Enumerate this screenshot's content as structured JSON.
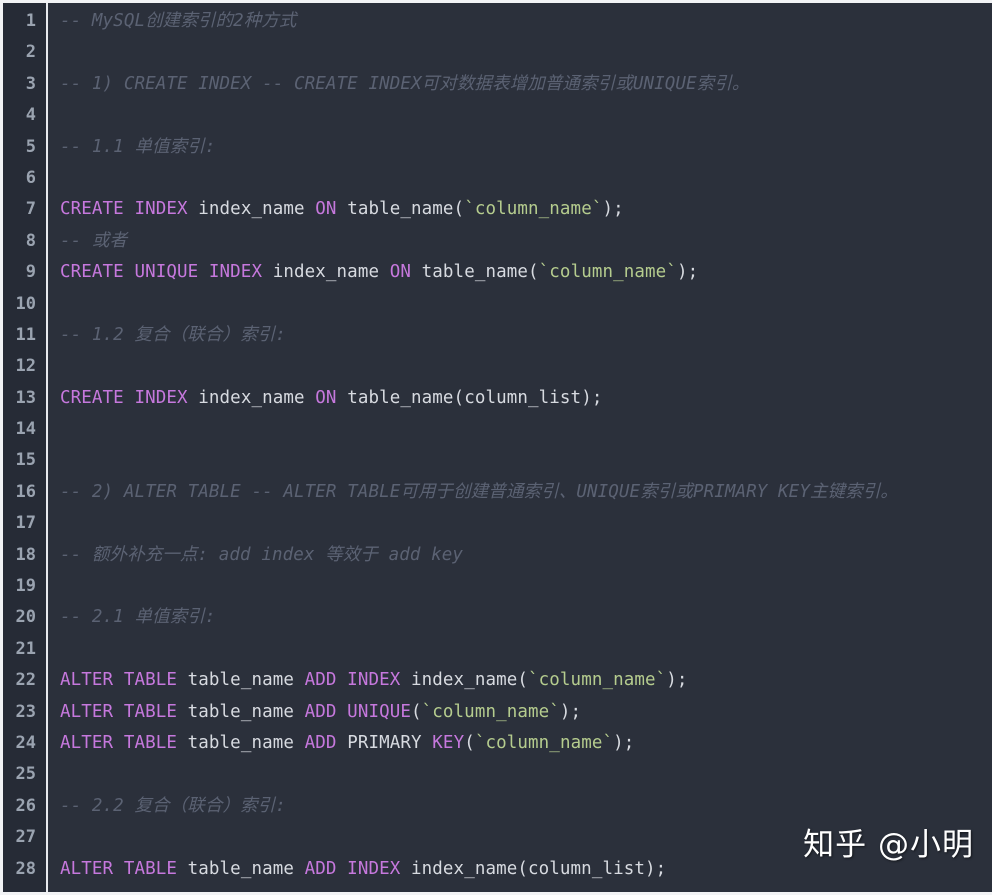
{
  "editor": {
    "language": "sql",
    "theme": "one-dark",
    "total_lines": 28,
    "colors": {
      "background": "#2b303b",
      "gutter_background": "#262b36",
      "gutter_separator": "#e8eaee",
      "frame_border": "#f2f3f5",
      "line_number": "#9aa3b0",
      "comment": "#5b6273",
      "keyword": "#c678dd",
      "identifier": "#d7dae0",
      "string": "#b5cc8e",
      "watermark": "#ffffff"
    }
  },
  "watermark": {
    "text": "知乎 @小明"
  },
  "lines": [
    {
      "n": "1",
      "tokens": [
        {
          "t": "-- MySQL创建索引的2种方式",
          "c": "comment"
        }
      ]
    },
    {
      "n": "2",
      "tokens": []
    },
    {
      "n": "3",
      "tokens": [
        {
          "t": "-- 1) CREATE INDEX -- CREATE INDEX可对数据表增加普通索引或UNIQUE索引。",
          "c": "comment"
        }
      ]
    },
    {
      "n": "4",
      "tokens": []
    },
    {
      "n": "5",
      "tokens": [
        {
          "t": "-- 1.1 单值索引:",
          "c": "comment"
        }
      ]
    },
    {
      "n": "6",
      "tokens": []
    },
    {
      "n": "7",
      "tokens": [
        {
          "t": "CREATE INDEX",
          "c": "keyword"
        },
        {
          "t": " index_name ",
          "c": "ident"
        },
        {
          "t": "ON",
          "c": "keyword"
        },
        {
          "t": " table_name(",
          "c": "ident"
        },
        {
          "t": "`column_name`",
          "c": "string"
        },
        {
          "t": ");",
          "c": "punct"
        }
      ]
    },
    {
      "n": "8",
      "tokens": [
        {
          "t": "-- 或者",
          "c": "comment"
        }
      ]
    },
    {
      "n": "9",
      "tokens": [
        {
          "t": "CREATE UNIQUE INDEX",
          "c": "keyword"
        },
        {
          "t": " index_name ",
          "c": "ident"
        },
        {
          "t": "ON",
          "c": "keyword"
        },
        {
          "t": " table_name(",
          "c": "ident"
        },
        {
          "t": "`column_name`",
          "c": "string"
        },
        {
          "t": ");",
          "c": "punct"
        }
      ]
    },
    {
      "n": "10",
      "tokens": []
    },
    {
      "n": "11",
      "tokens": [
        {
          "t": "-- 1.2 复合（联合）索引:",
          "c": "comment"
        }
      ]
    },
    {
      "n": "12",
      "tokens": []
    },
    {
      "n": "13",
      "tokens": [
        {
          "t": "CREATE INDEX",
          "c": "keyword"
        },
        {
          "t": " index_name ",
          "c": "ident"
        },
        {
          "t": "ON",
          "c": "keyword"
        },
        {
          "t": " table_name(column_list);",
          "c": "ident"
        }
      ]
    },
    {
      "n": "14",
      "tokens": []
    },
    {
      "n": "15",
      "tokens": []
    },
    {
      "n": "16",
      "tokens": [
        {
          "t": "-- 2) ALTER TABLE -- ALTER TABLE可用于创建普通索引、UNIQUE索引或PRIMARY KEY主键索引。",
          "c": "comment"
        }
      ]
    },
    {
      "n": "17",
      "tokens": []
    },
    {
      "n": "18",
      "tokens": [
        {
          "t": "-- 额外补充一点: add index 等效于 add key",
          "c": "comment"
        }
      ]
    },
    {
      "n": "19",
      "tokens": []
    },
    {
      "n": "20",
      "tokens": [
        {
          "t": "-- 2.1 单值索引:",
          "c": "comment"
        }
      ]
    },
    {
      "n": "21",
      "tokens": []
    },
    {
      "n": "22",
      "tokens": [
        {
          "t": "ALTER TABLE",
          "c": "keyword"
        },
        {
          "t": " table_name ",
          "c": "ident"
        },
        {
          "t": "ADD INDEX",
          "c": "keyword"
        },
        {
          "t": " index_name(",
          "c": "ident"
        },
        {
          "t": "`column_name`",
          "c": "string"
        },
        {
          "t": ");",
          "c": "punct"
        }
      ]
    },
    {
      "n": "23",
      "tokens": [
        {
          "t": "ALTER TABLE",
          "c": "keyword"
        },
        {
          "t": " table_name ",
          "c": "ident"
        },
        {
          "t": "ADD UNIQUE",
          "c": "keyword"
        },
        {
          "t": "(",
          "c": "punct"
        },
        {
          "t": "`column_name`",
          "c": "string"
        },
        {
          "t": ");",
          "c": "punct"
        }
      ]
    },
    {
      "n": "24",
      "tokens": [
        {
          "t": "ALTER TABLE",
          "c": "keyword"
        },
        {
          "t": " table_name ",
          "c": "ident"
        },
        {
          "t": "ADD",
          "c": "keyword"
        },
        {
          "t": " PRIMARY ",
          "c": "ident"
        },
        {
          "t": "KEY",
          "c": "keyword"
        },
        {
          "t": "(",
          "c": "punct"
        },
        {
          "t": "`column_name`",
          "c": "string"
        },
        {
          "t": ");",
          "c": "punct"
        }
      ]
    },
    {
      "n": "25",
      "tokens": []
    },
    {
      "n": "26",
      "tokens": [
        {
          "t": "-- 2.2 复合（联合）索引:",
          "c": "comment"
        }
      ]
    },
    {
      "n": "27",
      "tokens": []
    },
    {
      "n": "28",
      "tokens": [
        {
          "t": "ALTER TABLE",
          "c": "keyword"
        },
        {
          "t": " table_name ",
          "c": "ident"
        },
        {
          "t": "ADD INDEX",
          "c": "keyword"
        },
        {
          "t": " index_name(column_list);",
          "c": "ident"
        }
      ]
    }
  ]
}
